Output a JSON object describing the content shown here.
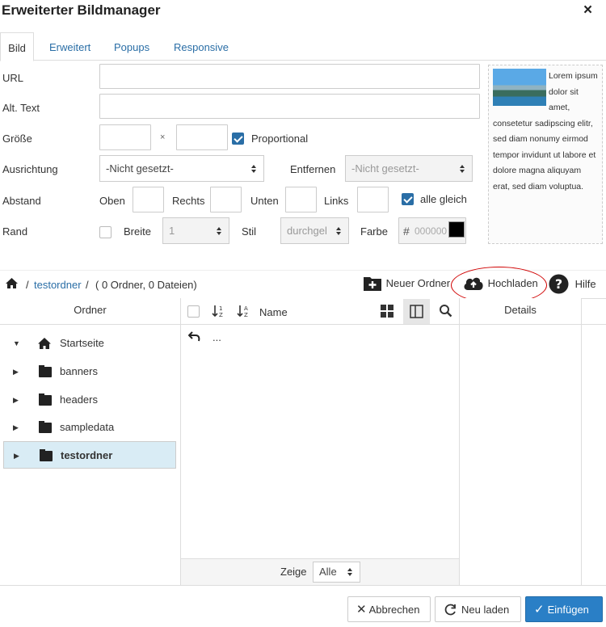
{
  "dialog": {
    "title": "Erweiterter Bildmanager",
    "close": "×"
  },
  "tabs": [
    "Bild",
    "Erweitert",
    "Popups",
    "Responsive"
  ],
  "form": {
    "url_label": "URL",
    "alt_label": "Alt. Text",
    "size_label": "Größe",
    "size_sep": "×",
    "proportional_label": "Proportional",
    "align_label": "Ausrichtung",
    "align_value": "-Nicht gesetzt-",
    "remove_label": "Entfernen",
    "remove_value": "-Nicht gesetzt-",
    "spacing_label": "Abstand",
    "top_label": "Oben",
    "right_label": "Rechts",
    "bottom_label": "Unten",
    "left_label": "Links",
    "all_equal_label": "alle gleich",
    "border_label": "Rand",
    "width_label": "Breite",
    "width_value": "1",
    "style_label": "Stil",
    "style_value": "durchgel",
    "color_label": "Farbe",
    "color_hash": "#",
    "color_placeholder": "000000"
  },
  "preview": {
    "text": "Lorem ipsum dolor sit amet, consetetur sadipscing elitr, sed diam nonumy eirmod tempor invidunt ut labore et dolore magna aliquyam erat, sed diam voluptua."
  },
  "path": {
    "sep1": "/",
    "folder": "testordner",
    "sep2": "/",
    "info": "( 0 Ordner, 0 Dateien)"
  },
  "toolbar": {
    "new_folder": "Neuer Ordner",
    "upload": "Hochladen",
    "help": "Hilfe"
  },
  "columns": {
    "folders": "Ordner",
    "name": "Name",
    "details": "Details"
  },
  "tree": [
    {
      "label": "Startseite",
      "expanded": true
    },
    {
      "label": "banners"
    },
    {
      "label": "headers"
    },
    {
      "label": "sampledata"
    },
    {
      "label": "testordner",
      "selected": true
    }
  ],
  "files": {
    "up": "..."
  },
  "footer": {
    "show_label": "Zeige",
    "show_value": "Alle"
  },
  "buttons": {
    "cancel": "Abbrechen",
    "reload": "Neu laden",
    "insert": "Einfügen"
  },
  "colors": {
    "accent": "#2a6ea6",
    "primary_button": "#2a7fc6",
    "selected_row": "#d9ecf5",
    "highlight_circle": "#d00000"
  }
}
